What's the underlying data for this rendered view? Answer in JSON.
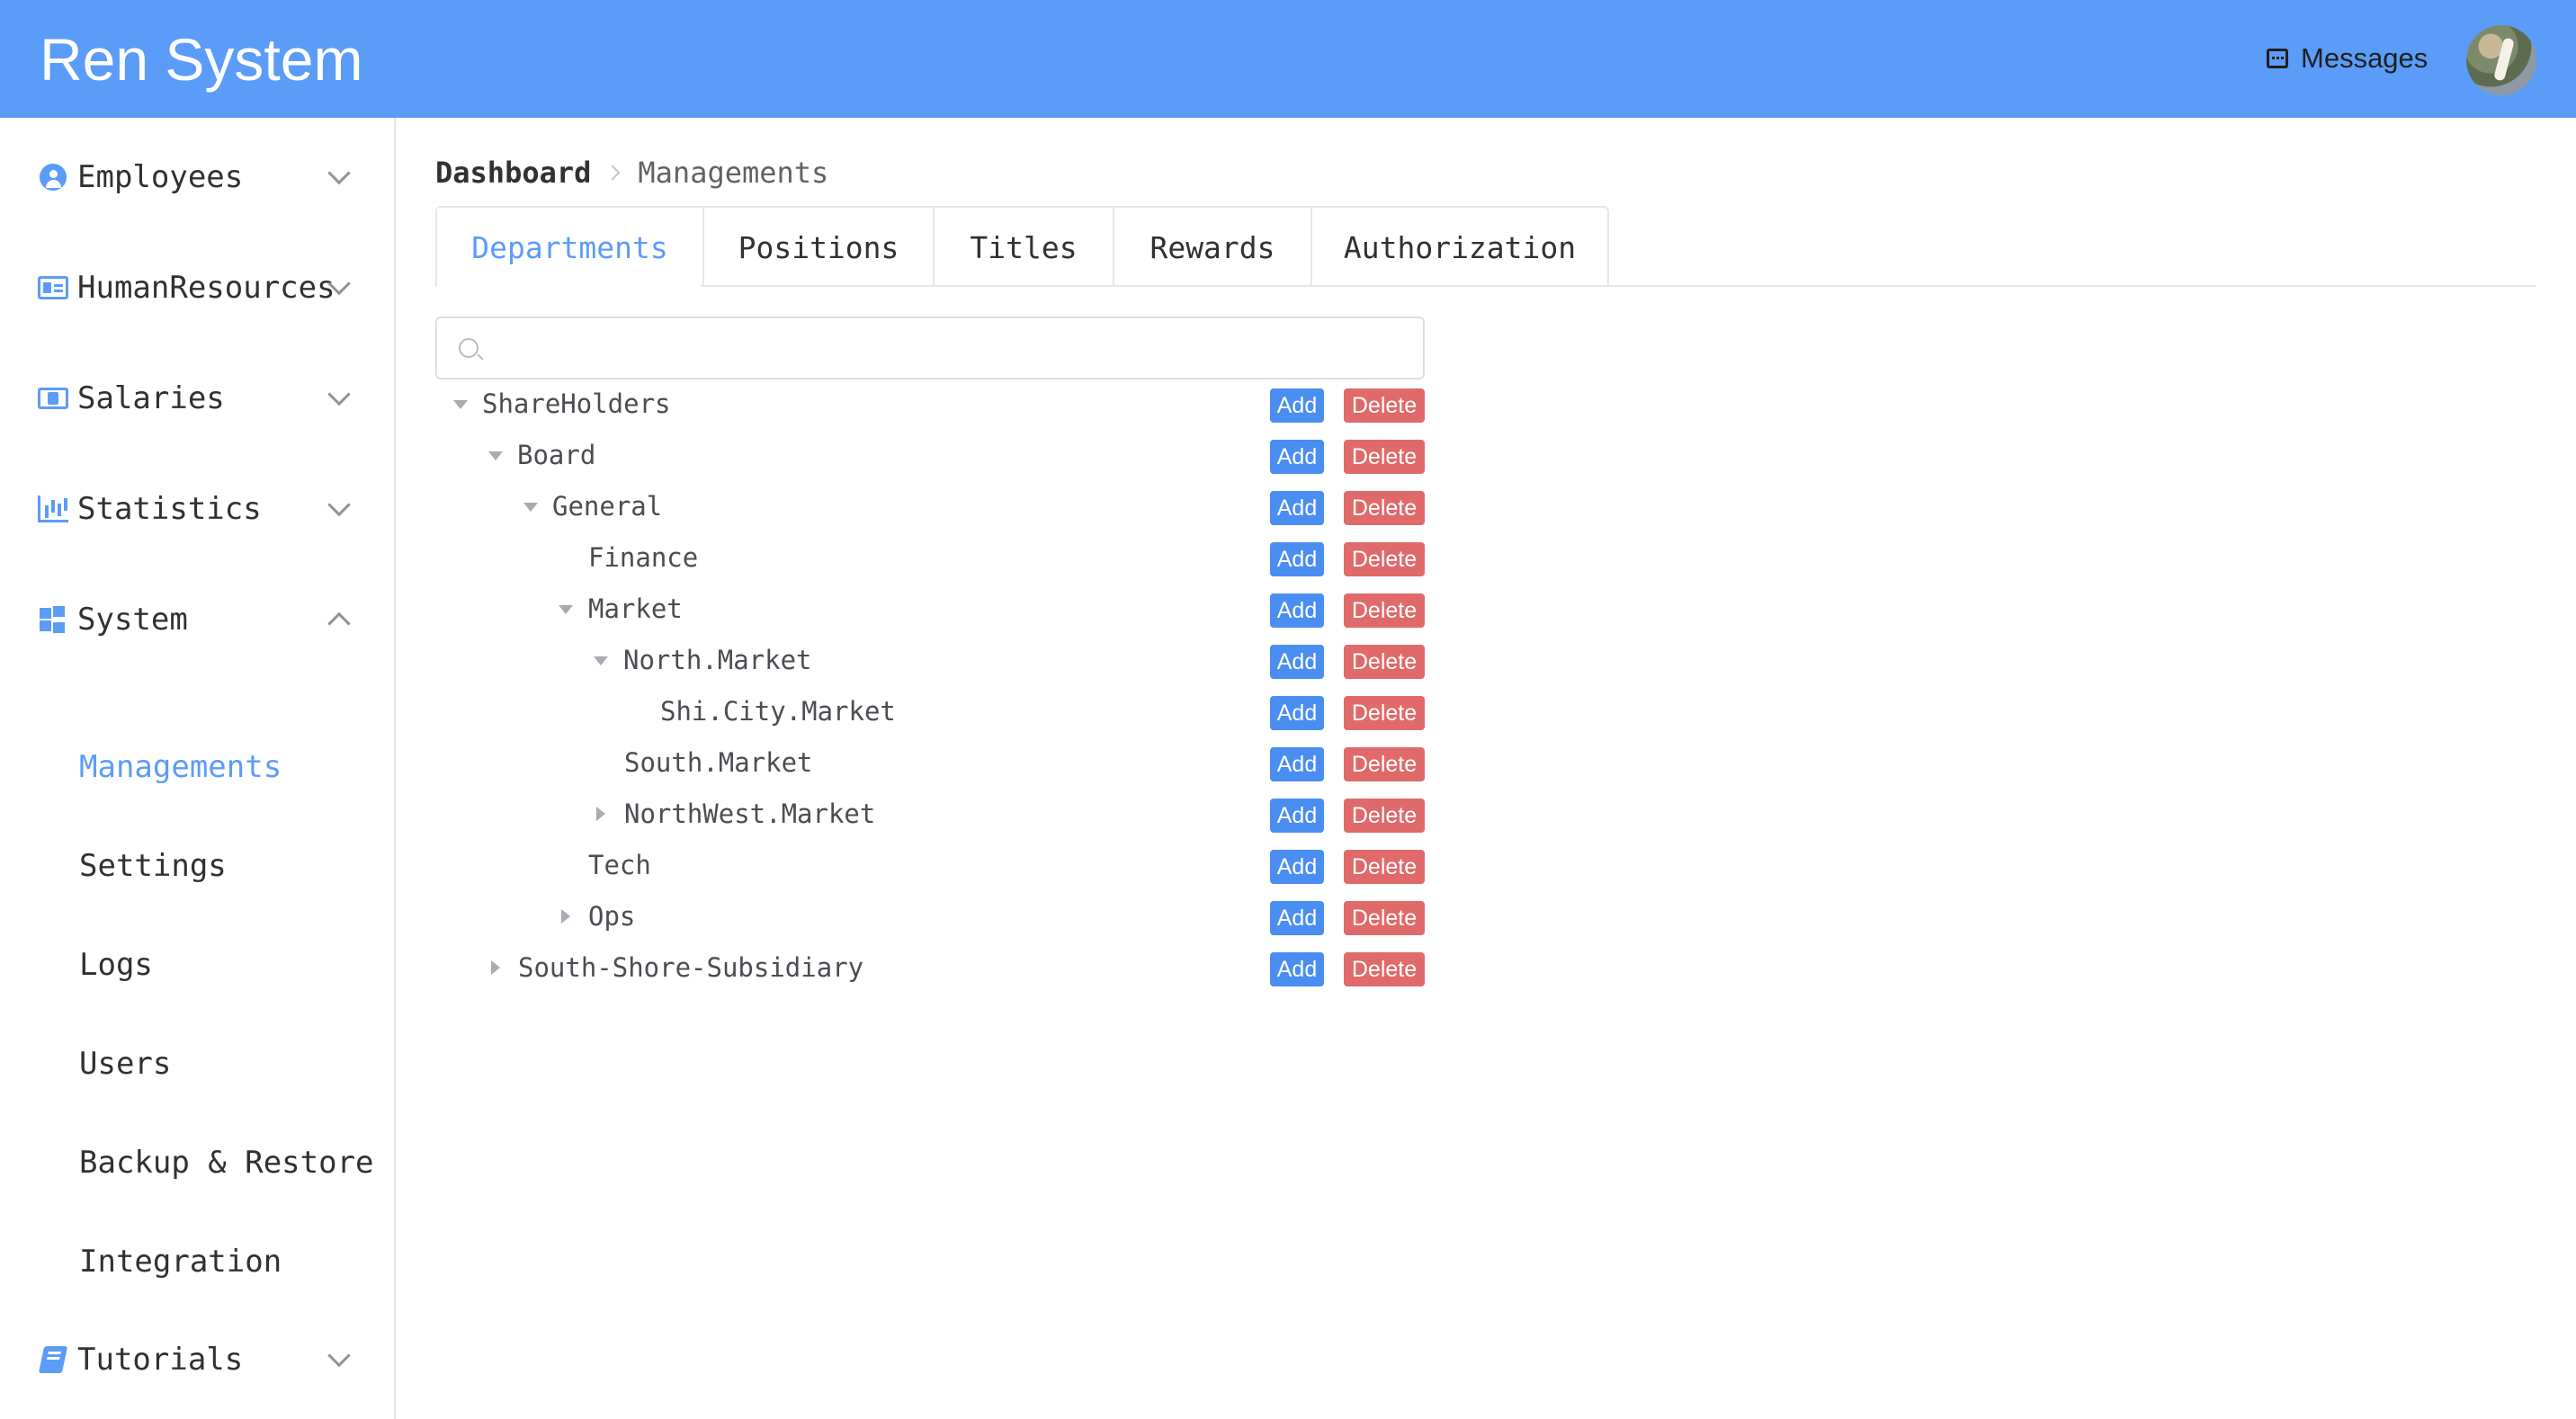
{
  "header": {
    "title": "Ren System",
    "messages_label": "Messages",
    "avatar_icon": "user-avatar"
  },
  "sidebar": {
    "items": [
      {
        "label": "Employees",
        "icon": "user-circle-icon",
        "expanded": false
      },
      {
        "label": "HumanResources",
        "icon": "id-card-icon",
        "expanded": false
      },
      {
        "label": "Salaries",
        "icon": "money-icon",
        "expanded": false
      },
      {
        "label": "Statistics",
        "icon": "bar-chart-icon",
        "expanded": false
      },
      {
        "label": "System",
        "icon": "windows-icon",
        "expanded": true
      },
      {
        "label": "Tutorials",
        "icon": "book-icon",
        "expanded": false
      }
    ],
    "system_children": [
      {
        "label": "Managements",
        "active": true
      },
      {
        "label": "Settings",
        "active": false
      },
      {
        "label": "Logs",
        "active": false
      },
      {
        "label": "Users",
        "active": false
      },
      {
        "label": "Backup & Restore",
        "active": false
      },
      {
        "label": "Integration",
        "active": false
      }
    ]
  },
  "breadcrumb": {
    "home": "Dashboard",
    "current": "Managements"
  },
  "tabs": [
    {
      "label": "Departments",
      "active": true
    },
    {
      "label": "Positions",
      "active": false
    },
    {
      "label": "Titles",
      "active": false
    },
    {
      "label": "Rewards",
      "active": false
    },
    {
      "label": "Authorization",
      "active": false
    }
  ],
  "search": {
    "value": "",
    "placeholder": ""
  },
  "tree": {
    "add_label": "Add",
    "delete_label": "Delete",
    "nodes": [
      {
        "label": "ShareHolders",
        "depth": 0,
        "caret": "open"
      },
      {
        "label": "Board",
        "depth": 1,
        "caret": "open"
      },
      {
        "label": "General",
        "depth": 2,
        "caret": "open"
      },
      {
        "label": "Finance",
        "depth": 3,
        "caret": "none"
      },
      {
        "label": "Market",
        "depth": 3,
        "caret": "open"
      },
      {
        "label": "North.Market",
        "depth": 4,
        "caret": "open"
      },
      {
        "label": "Shi.City.Market",
        "depth": 5,
        "caret": "none"
      },
      {
        "label": "South.Market",
        "depth": 4,
        "caret": "none"
      },
      {
        "label": "NorthWest.Market",
        "depth": 4,
        "caret": "closed"
      },
      {
        "label": "Tech",
        "depth": 3,
        "caret": "none"
      },
      {
        "label": "Ops",
        "depth": 3,
        "caret": "closed"
      },
      {
        "label": "South-Shore-Subsidiary",
        "depth": 1,
        "caret": "closed"
      }
    ]
  },
  "colors": {
    "header_bg": "#5b9cf8",
    "accent": "#5b9cf8",
    "add_button": "#4a8ef2",
    "delete_button": "#e06a6a"
  }
}
